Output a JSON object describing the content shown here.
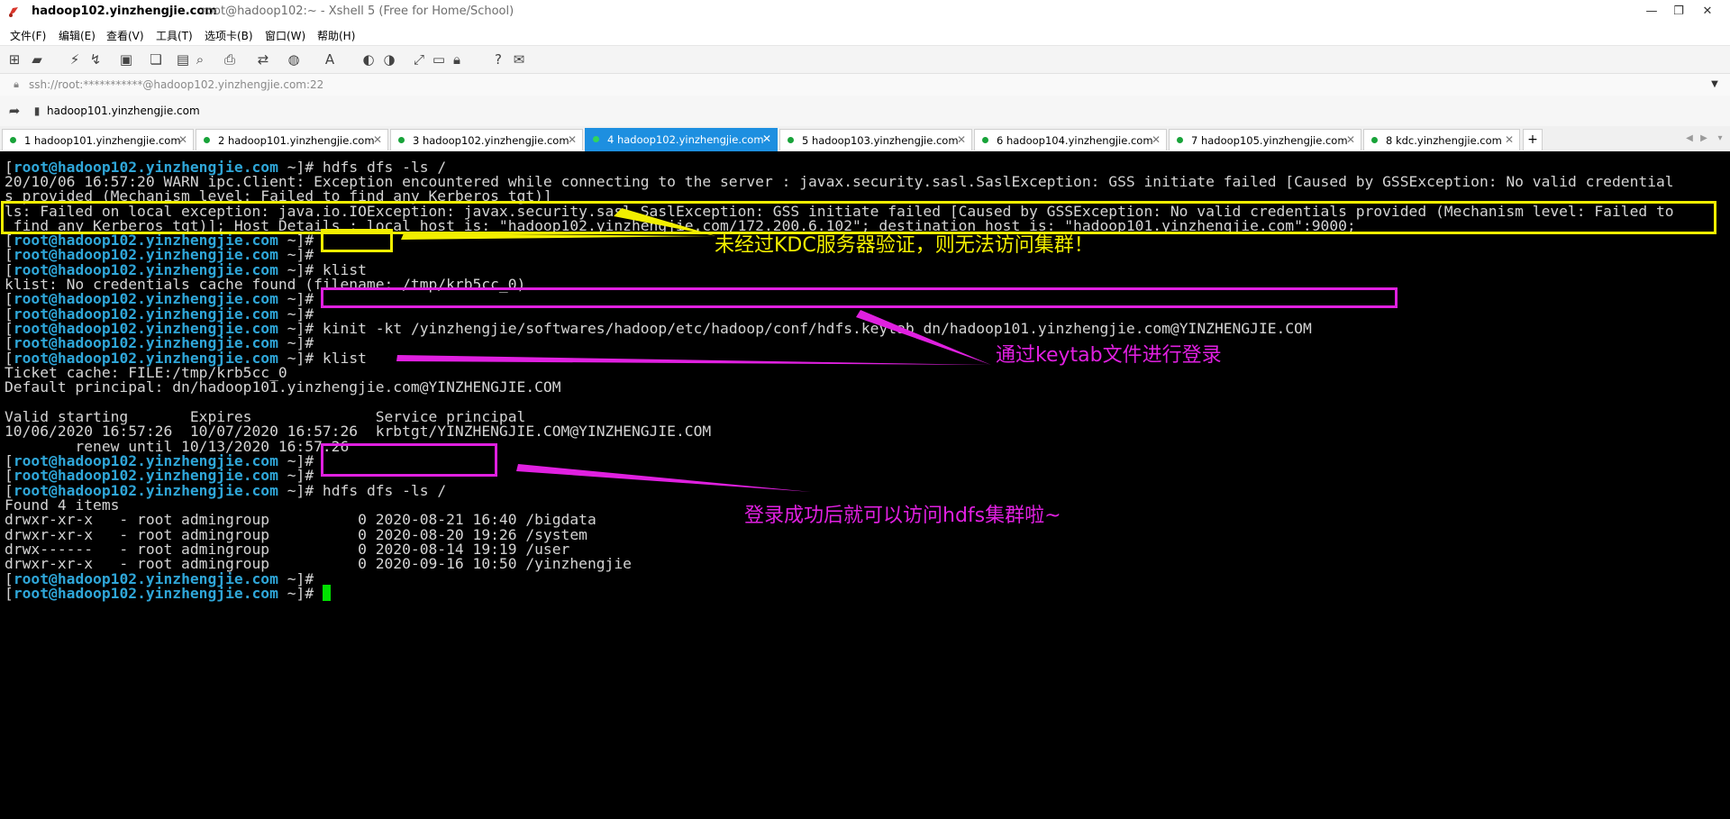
{
  "window": {
    "title": "hadoop102.yinzhengjie.com",
    "subtitle": "root@hadoop102:~ - Xshell 5 (Free for Home/School)",
    "controls": [
      "—",
      "❐",
      "✕"
    ]
  },
  "menu": [
    "文件(F)",
    "编辑(E)",
    "查看(V)",
    "工具(T)",
    "选项卡(B)",
    "窗口(W)",
    "帮助(H)"
  ],
  "address": {
    "value": "ssh://root:***********@hadoop102.yinzhengjie.com:22"
  },
  "links": {
    "label": "hadoop101.yinzhengjie.com"
  },
  "tabs": [
    {
      "label": "1 hadoop101.yinzhengjie.com"
    },
    {
      "label": "2 hadoop101.yinzhengjie.com"
    },
    {
      "label": "3 hadoop102.yinzhengjie.com"
    },
    {
      "label": "4 hadoop102.yinzhengjie.com"
    },
    {
      "label": "5 hadoop103.yinzhengjie.com"
    },
    {
      "label": "6 hadoop104.yinzhengjie.com"
    },
    {
      "label": "7 hadoop105.yinzhengjie.com"
    },
    {
      "label": "8 kdc.yinzhengjie.com"
    }
  ],
  "tab_add": "+",
  "prompt": {
    "open": "[",
    "user": "root",
    "at": "@",
    "host": "hadoop102.yinzhengjie.com",
    "close": " ~]#"
  },
  "terminal": {
    "cmd_ls": " hdfs dfs -ls /",
    "warn_1": "20/10/06 16:57:20 WARN ipc.Client: Exception encountered while connecting to the server : javax.security.sasl.SaslException: GSS initiate failed [Caused by GSSException: No valid credential",
    "warn_2": "s provided (Mechanism level: Failed to find any Kerberos tgt)]",
    "err_1": "ls: Failed on local exception: java.io.IOException: javax.security.sasl.SaslException: GSS initiate failed [Caused by GSSException: No valid credentials provided (Mechanism level: Failed to",
    "err_2": " find any Kerberos tgt)]; Host Details : local host is: \"hadoop102.yinzhengjie.com/172.200.6.102\"; destination host is: \"hadoop101.yinzhengjie.com\":9000;",
    "cmd_klist": " klist",
    "klist_err": "klist: No credentials cache found (filename: /tmp/krb5cc_0)",
    "cmd_kinit": " kinit -kt /yinzhengjie/softwares/hadoop/etc/hadoop/conf/hdfs.keytab dn/hadoop101.yinzhengjie.com@YINZHENGJIE.COM",
    "ticket_cache": "Ticket cache: FILE:/tmp/krb5cc_0",
    "principal": "Default principal: dn/hadoop101.yinzhengjie.com@YINZHENGJIE.COM",
    "table_header": "Valid starting       Expires              Service principal",
    "table_row": "10/06/2020 16:57:26  10/07/2020 16:57:26  krbtgt/YINZHENGJIE.COM@YINZHENGJIE.COM",
    "renew": "        renew until 10/13/2020 16:57:26",
    "found": "Found 4 items",
    "files": [
      "drwxr-xr-x   - root admingroup          0 2020-08-21 16:40 /bigdata",
      "drwxr-xr-x   - root admingroup          0 2020-08-20 19:26 /system",
      "drwx------   - root admingroup          0 2020-08-14 19:19 /user",
      "drwxr-xr-x   - root admingroup          0 2020-09-16 10:50 /yinzhengjie"
    ]
  },
  "annotations": {
    "kdc_note": "未经过KDC服务器验证，则无法访问集群！",
    "keytab_note": "通过keytab文件进行登录",
    "success_note": "登录成功后就可以访问hdfs集群啦~"
  },
  "colors": {
    "prompt": "#2fa6d8",
    "highlight_yellow": "#f2ee00",
    "highlight_magenta": "#e020e0",
    "active_tab": "#1d8fe0",
    "cursor": "#00e000"
  }
}
